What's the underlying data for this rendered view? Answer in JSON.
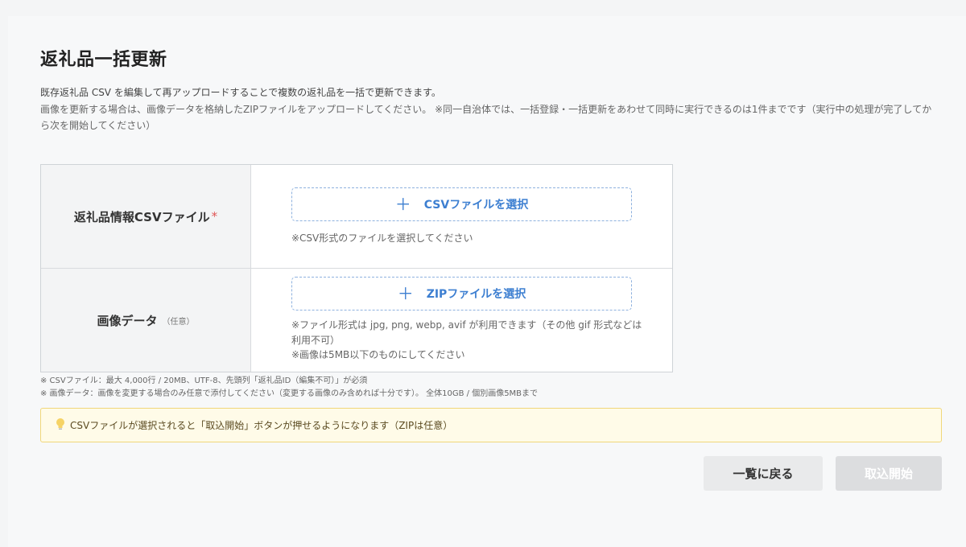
{
  "page": {
    "title": "返礼品一括更新",
    "description": "既存返礼品 CSV を編集して再アップロードすることで複数の返礼品を一括で更新できます。",
    "description_note": "画像を更新する場合は、画像データを格納したZIPファイルをアップロードしてください。 ※同一自治体では、一括登録・一括更新をあわせて同時に実行できるのは1件までです（実行中の処理が完了してから次を開始してください）"
  },
  "upload": {
    "csv": {
      "label": "返礼品情報CSVファイル",
      "required_mark": "*",
      "button_label": "CSVファイルを選択",
      "hint": "※CSV形式のファイルを選択してください"
    },
    "image": {
      "label": "画像データ",
      "optional_tag": "（任意）",
      "button_label": "ZIPファイルを選択",
      "hint_formats": "※ファイル形式は jpg, png, webp, avif が利用できます（その他 gif 形式などは利用不可）",
      "hint_size": "※画像は5MB以下のものにしてください"
    }
  },
  "footnotes": [
    "※ CSVファイル：最大 4,000行 / 20MB、UTF-8、先頭列「返礼品ID（編集不可）」が必須",
    "※ 画像データ：画像を変更する場合のみ任意で添付してください（変更する画像のみ含めれば十分です）。 全体10GB / 個別画像5MBまで"
  ],
  "notice": {
    "icon": "lightbulb-icon",
    "text": "CSVファイルが選択されると「取込開始」ボタンが押せるようになります（ZIPは任意）"
  },
  "actions": {
    "back_label": "一覧に戻る",
    "start_label": "取込開始",
    "start_enabled": false
  },
  "colors": {
    "accent": "#3d7fd1",
    "required": "#e05555",
    "notice_bg": "#fffbe8",
    "notice_border": "#f0d77a"
  }
}
